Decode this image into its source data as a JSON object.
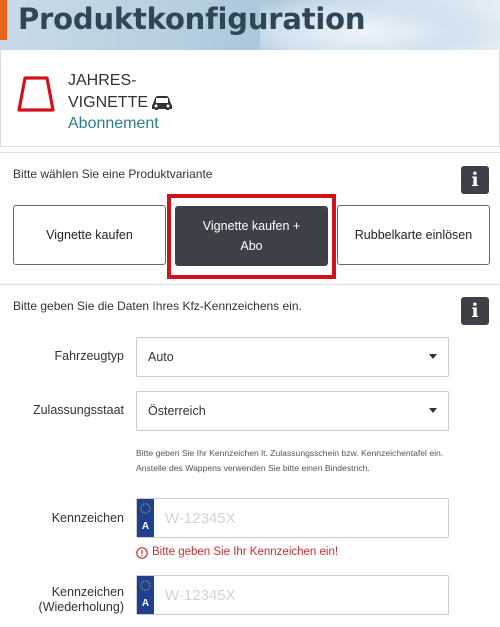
{
  "header": {
    "title": "Produktkonfiguration"
  },
  "product": {
    "name_line1": "JAHRES-",
    "name_line2": "VIGNETTE",
    "subtitle": "Abonnement",
    "icons": [
      "vignette-icon",
      "car-icon"
    ]
  },
  "variant_section": {
    "label": "Bitte wählen Sie eine Produktvariante",
    "info_glyph": "i",
    "options": [
      {
        "label": "Vignette kaufen",
        "selected": false
      },
      {
        "label_line1": "Vignette kaufen +",
        "label_line2": "Abo",
        "selected": true
      },
      {
        "label": "Rubbelkarte einlösen",
        "selected": false
      }
    ]
  },
  "plate_section": {
    "label": "Bitte geben Sie die Daten Ihres Kfz-Kennzeichens ein.",
    "info_glyph": "i",
    "vehicle_type": {
      "label": "Fahrzeugtyp",
      "value": "Auto"
    },
    "country": {
      "label": "Zulassungsstaat",
      "value": "Österreich"
    },
    "hint": "Bitte geben Sie Ihr Kennzeichen lt. Zulassungsschein bzw. Kennzeichentafel ein. Anstelle des Wappens verwenden Sie bitte einen Bindestrich.",
    "plate": {
      "label": "Kennzeichen",
      "placeholder": "W-12345X",
      "country_code": "A"
    },
    "error": "Bitte geben Sie Ihr Kennzeichen ein!",
    "plate_repeat": {
      "label_line1": "Kennzeichen",
      "label_line2": "(Wiederholung)",
      "placeholder": "W-12345X",
      "country_code": "A"
    }
  },
  "colors": {
    "accent": "#e8631b",
    "title": "#2f4656",
    "teal": "#2d7d8c",
    "dark_button": "#3d4147",
    "highlight": "#d5101d",
    "error": "#c9302c",
    "eu_blue": "#1f3f8f"
  }
}
